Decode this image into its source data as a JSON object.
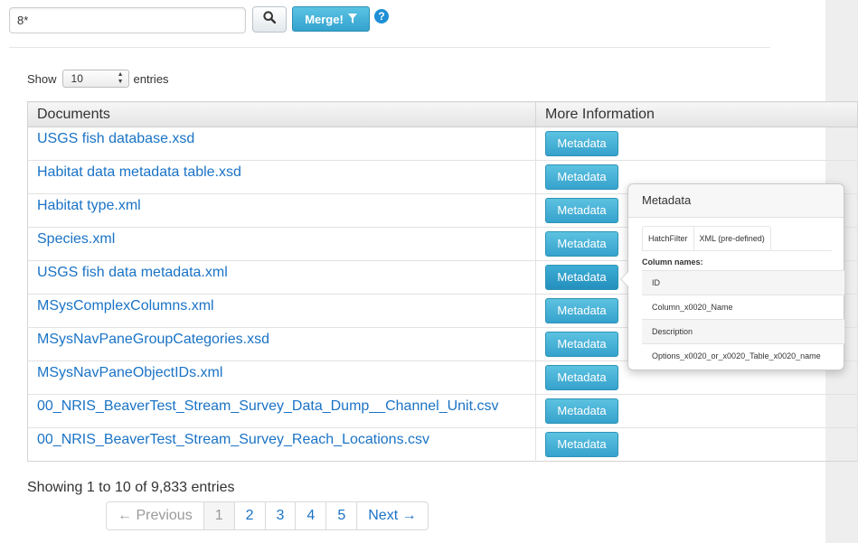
{
  "search": {
    "value": "8*"
  },
  "merge_button": {
    "label": "Merge!",
    "icon": "filter-icon"
  },
  "help": {
    "glyph": "?"
  },
  "length_menu": {
    "show_label": "Show",
    "selected": "10",
    "entries_label": "entries"
  },
  "table": {
    "headers": [
      "Documents",
      "More Information"
    ],
    "rows": [
      {
        "doc": "USGS fish database.xsd",
        "action": "Metadata"
      },
      {
        "doc": "Habitat data metadata table.xsd",
        "action": "Metadata"
      },
      {
        "doc": "Habitat type.xml",
        "action": "Metadata"
      },
      {
        "doc": "Species.xml",
        "action": "Metadata"
      },
      {
        "doc": "USGS fish data metadata.xml",
        "action": "Metadata"
      },
      {
        "doc": "MSysComplexColumns.xml",
        "action": "Metadata"
      },
      {
        "doc": "MSysNavPaneGroupCategories.xsd",
        "action": "Metadata"
      },
      {
        "doc": "MSysNavPaneObjectIDs.xml",
        "action": "Metadata"
      },
      {
        "doc": "00_NRIS_BeaverTest_Stream_Survey_Data_Dump__Channel_Unit.csv",
        "action": "Metadata"
      },
      {
        "doc": "00_NRIS_BeaverTest_Stream_Survey_Reach_Locations.csv",
        "action": "Metadata"
      }
    ]
  },
  "popover": {
    "title": "Metadata",
    "tabs": [
      "HatchFilter",
      "XML (pre-defined)"
    ],
    "column_label": "Column names:",
    "columns": [
      "ID",
      "Column_x0020_Name",
      "Description",
      "Options_x0020_or_x0020_Table_x0020_name"
    ]
  },
  "info": "Showing 1 to 10 of 9,833 entries",
  "pagination": {
    "previous": "← Previous",
    "pages": [
      "1",
      "2",
      "3",
      "4",
      "5"
    ],
    "next": "Next →"
  }
}
